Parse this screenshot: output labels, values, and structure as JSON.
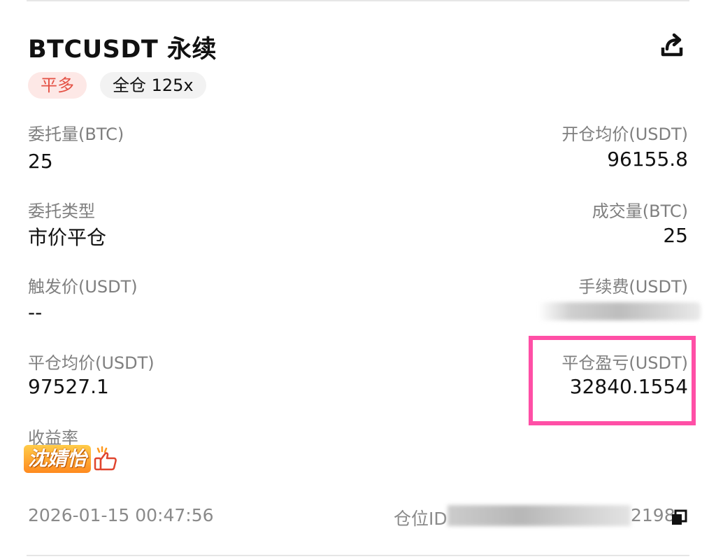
{
  "header": {
    "title": "BTCUSDT 永续",
    "share_icon": "share-icon"
  },
  "badges": {
    "side": "平多",
    "margin_mode": "全仓 125x"
  },
  "fields": {
    "order_qty": {
      "label": "委托量(BTC)",
      "value": "25"
    },
    "open_avg_price": {
      "label": "开仓均价(USDT)",
      "value": "96155.8"
    },
    "order_type": {
      "label": "委托类型",
      "value": "市价平仓"
    },
    "filled_qty": {
      "label": "成交量(BTC)",
      "value": "25"
    },
    "trigger_price": {
      "label": "触发价(USDT)",
      "value": "--"
    },
    "fee": {
      "label": "手续费(USDT)",
      "value": ""
    },
    "close_avg_price": {
      "label": "平仓均价(USDT)",
      "value": "97527.1"
    },
    "close_pnl": {
      "label": "平仓盈亏(USDT)",
      "value": "32840.1554"
    },
    "roi": {
      "label": "收益率",
      "value": ""
    }
  },
  "watermark": {
    "text": "沈婧怡"
  },
  "footer": {
    "timestamp": "2026-01-15 00:47:56",
    "position_id_label": "仓位ID",
    "position_id_suffix": "2198",
    "copy_icon": "copy-icon"
  },
  "colors": {
    "highlight": "#ff4fa6",
    "side_badge_text": "#e45144",
    "side_badge_bg": "#fde8e6"
  }
}
